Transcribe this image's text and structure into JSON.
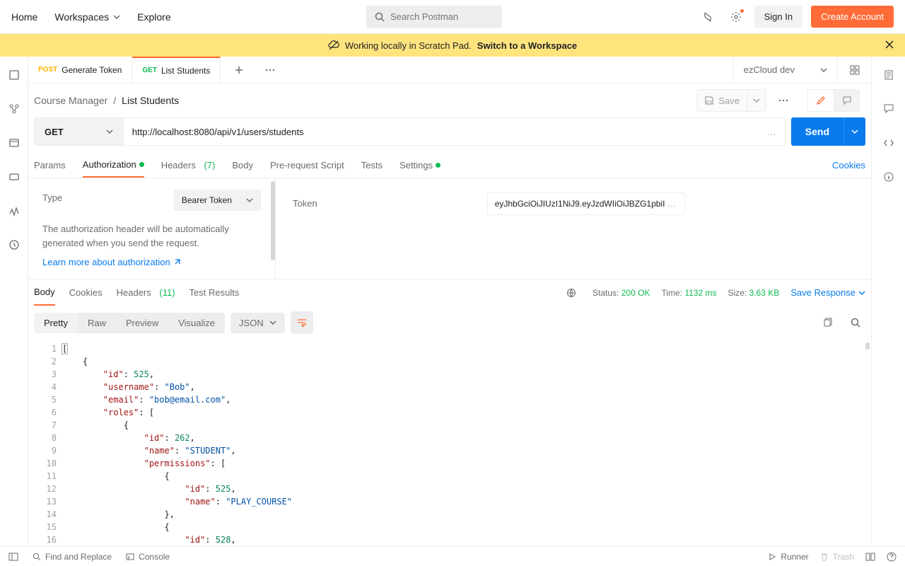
{
  "nav": {
    "home": "Home",
    "workspaces": "Workspaces",
    "explore": "Explore",
    "search_placeholder": "Search Postman",
    "signin": "Sign In",
    "create_account": "Create Account"
  },
  "banner": {
    "text": "Working locally in Scratch Pad.",
    "link": "Switch to a Workspace"
  },
  "tabs": [
    {
      "method": "POST",
      "label": "Generate Token",
      "active": false
    },
    {
      "method": "GET",
      "label": "List Students",
      "active": true
    }
  ],
  "env": {
    "name": "ezCloud dev"
  },
  "breadcrumb": {
    "parent": "Course Manager",
    "sep": "/",
    "current": "List Students"
  },
  "actions": {
    "save": "Save"
  },
  "request": {
    "method": "GET",
    "url": "http://localhost:8080/api/v1/users/students",
    "send": "Send"
  },
  "req_tabs": {
    "params": "Params",
    "auth": "Authorization",
    "headers": "Headers",
    "headers_count": "(7)",
    "body": "Body",
    "prereq": "Pre-request Script",
    "tests": "Tests",
    "settings": "Settings",
    "cookies": "Cookies"
  },
  "auth": {
    "type_label": "Type",
    "type_value": "Bearer Token",
    "desc": "The authorization header will be automatically generated when you send the request.",
    "learn_more": "Learn more about authorization",
    "token_label": "Token",
    "token_value": "eyJhbGciOiJIUzI1NiJ9.eyJzdWIiOiJBZG1pbiI"
  },
  "resp_tabs": {
    "body": "Body",
    "cookies": "Cookies",
    "headers": "Headers",
    "headers_count": "(11)",
    "test_results": "Test Results"
  },
  "resp_meta": {
    "status_label": "Status:",
    "status_val": "200 OK",
    "time_label": "Time:",
    "time_val": "1132 ms",
    "size_label": "Size:",
    "size_val": "3.63 KB",
    "save_response": "Save Response"
  },
  "view": {
    "pretty": "Pretty",
    "raw": "Raw",
    "preview": "Preview",
    "visualize": "Visualize",
    "format": "JSON"
  },
  "code_lines": [
    [
      {
        "t": "[",
        "c": "punc",
        "box": true
      }
    ],
    [
      {
        "t": "    {",
        "c": "punc"
      }
    ],
    [
      {
        "t": "        ",
        "c": "punc"
      },
      {
        "t": "\"id\"",
        "c": "key"
      },
      {
        "t": ": ",
        "c": "punc"
      },
      {
        "t": "525",
        "c": "num"
      },
      {
        "t": ",",
        "c": "punc"
      }
    ],
    [
      {
        "t": "        ",
        "c": "punc"
      },
      {
        "t": "\"username\"",
        "c": "key"
      },
      {
        "t": ": ",
        "c": "punc"
      },
      {
        "t": "\"Bob\"",
        "c": "str"
      },
      {
        "t": ",",
        "c": "punc"
      }
    ],
    [
      {
        "t": "        ",
        "c": "punc"
      },
      {
        "t": "\"email\"",
        "c": "key"
      },
      {
        "t": ": ",
        "c": "punc"
      },
      {
        "t": "\"bob@email.com\"",
        "c": "str"
      },
      {
        "t": ",",
        "c": "punc"
      }
    ],
    [
      {
        "t": "        ",
        "c": "punc"
      },
      {
        "t": "\"roles\"",
        "c": "key"
      },
      {
        "t": ": [",
        "c": "punc"
      }
    ],
    [
      {
        "t": "            {",
        "c": "punc"
      }
    ],
    [
      {
        "t": "                ",
        "c": "punc"
      },
      {
        "t": "\"id\"",
        "c": "key"
      },
      {
        "t": ": ",
        "c": "punc"
      },
      {
        "t": "262",
        "c": "num"
      },
      {
        "t": ",",
        "c": "punc"
      }
    ],
    [
      {
        "t": "                ",
        "c": "punc"
      },
      {
        "t": "\"name\"",
        "c": "key"
      },
      {
        "t": ": ",
        "c": "punc"
      },
      {
        "t": "\"STUDENT\"",
        "c": "str"
      },
      {
        "t": ",",
        "c": "punc"
      }
    ],
    [
      {
        "t": "                ",
        "c": "punc"
      },
      {
        "t": "\"permissions\"",
        "c": "key"
      },
      {
        "t": ": [",
        "c": "punc"
      }
    ],
    [
      {
        "t": "                    {",
        "c": "punc"
      }
    ],
    [
      {
        "t": "                        ",
        "c": "punc"
      },
      {
        "t": "\"id\"",
        "c": "key"
      },
      {
        "t": ": ",
        "c": "punc"
      },
      {
        "t": "525",
        "c": "num"
      },
      {
        "t": ",",
        "c": "punc"
      }
    ],
    [
      {
        "t": "                        ",
        "c": "punc"
      },
      {
        "t": "\"name\"",
        "c": "key"
      },
      {
        "t": ": ",
        "c": "punc"
      },
      {
        "t": "\"PLAY_COURSE\"",
        "c": "str"
      }
    ],
    [
      {
        "t": "                    },",
        "c": "punc"
      }
    ],
    [
      {
        "t": "                    {",
        "c": "punc"
      }
    ],
    [
      {
        "t": "                        ",
        "c": "punc"
      },
      {
        "t": "\"id\"",
        "c": "key"
      },
      {
        "t": ": ",
        "c": "punc"
      },
      {
        "t": "528",
        "c": "num"
      },
      {
        "t": ",",
        "c": "punc"
      }
    ]
  ],
  "bottom": {
    "find_replace": "Find and Replace",
    "console": "Console",
    "runner": "Runner",
    "trash": "Trash"
  }
}
